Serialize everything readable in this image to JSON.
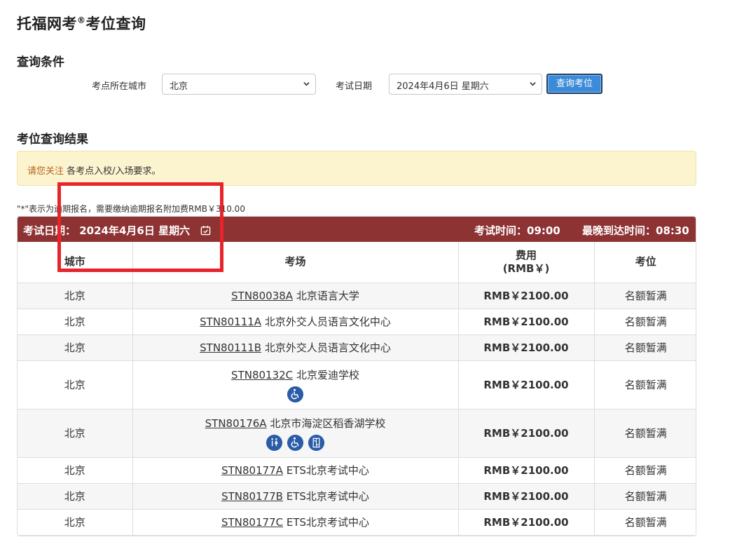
{
  "page": {
    "title": "托福网考",
    "title_sup": "®",
    "title_suffix": "考位查询"
  },
  "query": {
    "section_title": "查询条件",
    "city_label": "考点所在城市",
    "city_value": "北京",
    "date_label": "考试日期",
    "date_value": "2024年4月6日 星期六",
    "button_label": "查询考位"
  },
  "result": {
    "section_title": "考位查询结果",
    "alert_highlight": "请您关注",
    "alert_text": " 各考点入校/入场要求。",
    "note": "\"*\"表示为逾期报名，需要缴纳逾期报名附加费RMB￥310.00",
    "date_bar": {
      "date_label": "考试日期：",
      "date_value": "2024年4月6日 星期六",
      "exam_time": "考试时间：09:00",
      "latest_arrival": "最晚到达时间：08:30"
    },
    "headers": {
      "city": "城市",
      "venue": "考场",
      "fee_line1": "费用",
      "fee_line2": "(RMB￥)",
      "seat": "考位"
    },
    "rows": [
      {
        "city": "北京",
        "code": "STN80038A",
        "name": "北京语言大学",
        "fee": "RMB￥2100.00",
        "seat": "名额暂满"
      },
      {
        "city": "北京",
        "code": "STN80111A",
        "name": "北京外交人员语言文化中心",
        "fee": "RMB￥2100.00",
        "seat": "名额暂满"
      },
      {
        "city": "北京",
        "code": "STN80111B",
        "name": "北京外交人员语言文化中心",
        "fee": "RMB￥2100.00",
        "seat": "名额暂满"
      },
      {
        "city": "北京",
        "code": "STN80132C",
        "name": "北京爱迪学校",
        "fee": "RMB￥2100.00",
        "seat": "名额暂满"
      },
      {
        "city": "北京",
        "code": "STN80176A",
        "name": "北京市海淀区稻香湖学校",
        "fee": "RMB￥2100.00",
        "seat": "名额暂满"
      },
      {
        "city": "北京",
        "code": "STN80177A",
        "name": "ETS北京考试中心",
        "fee": "RMB￥2100.00",
        "seat": "名额暂满"
      },
      {
        "city": "北京",
        "code": "STN80177B",
        "name": "ETS北京考试中心",
        "fee": "RMB￥2100.00",
        "seat": "名额暂满"
      },
      {
        "city": "北京",
        "code": "STN80177C",
        "name": "ETS北京考试中心",
        "fee": "RMB￥2100.00",
        "seat": "名额暂满"
      }
    ]
  },
  "colors": {
    "header_bar": "#8e3333",
    "accent_button": "#3b8bd9",
    "alert_bg": "#fcf3cf",
    "icon_blue": "#2a5ca8",
    "annotation_red": "#e8242b"
  },
  "icons": {
    "calendar": "calendar-check-icon",
    "wheelchair": "wheelchair-icon",
    "restroom": "restroom-icon",
    "elevator": "elevator-icon"
  }
}
